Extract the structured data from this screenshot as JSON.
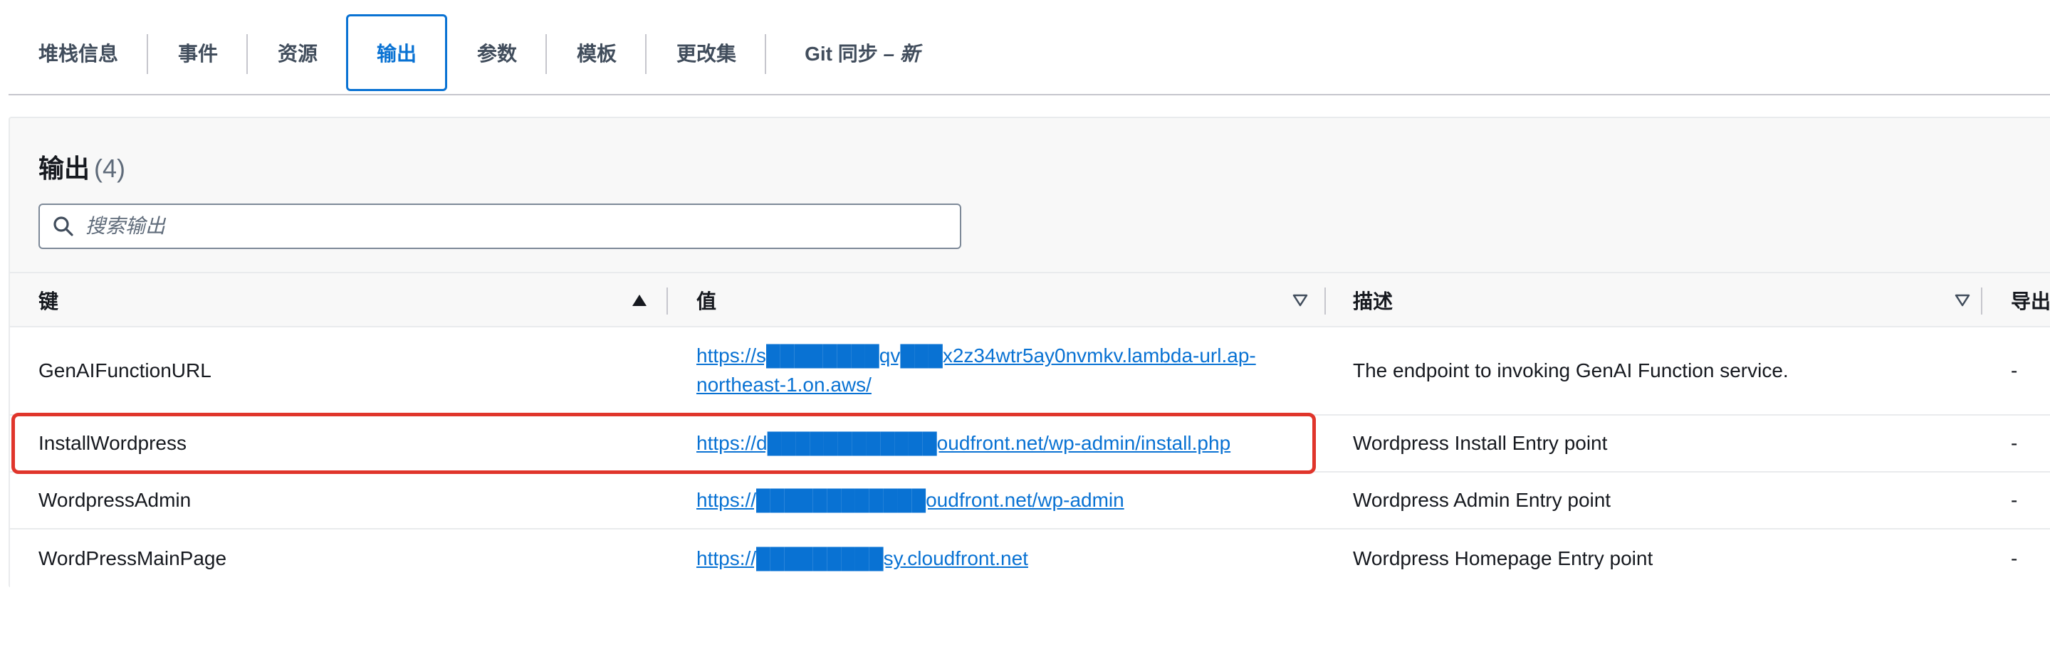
{
  "tabs": [
    {
      "label": "堆栈信息"
    },
    {
      "label": "事件"
    },
    {
      "label": "资源"
    },
    {
      "label": "输出"
    },
    {
      "label": "参数"
    },
    {
      "label": "模板"
    },
    {
      "label": "更改集"
    },
    {
      "label": "Git 同步",
      "suffix": "– 新"
    }
  ],
  "active_tab": "输出",
  "outputs": {
    "title": "输出",
    "count": "(4)",
    "search_placeholder": "搜索输出",
    "columns": {
      "key": "键",
      "value": "值",
      "description": "描述",
      "export": "导出"
    },
    "rows": [
      {
        "key": "GenAIFunctionURL",
        "value_line1": "https://s████████qv███x2z34wtr5ay0nvmkv.lambda-url.ap-",
        "value_line2": "northeast-1.on.aws/",
        "description": "The endpoint to invoking GenAI Function service.",
        "export": "-"
      },
      {
        "key": "InstallWordpress",
        "value": "https://d████████████oudfront.net/wp-admin/install.php",
        "description": "Wordpress Install Entry point",
        "export": "-"
      },
      {
        "key": "WordpressAdmin",
        "value": "https://████████████oudfront.net/wp-admin",
        "description": "Wordpress Admin Entry point",
        "export": "-"
      },
      {
        "key": "WordPressMainPage",
        "value": "https://█████████sy.cloudfront.net",
        "description": "Wordpress Homepage Entry point",
        "export": "-"
      }
    ]
  },
  "colors": {
    "accent": "#0972d3",
    "highlight": "#e0352b"
  },
  "icons": {
    "search": "search-icon",
    "sort_asc": "sort-ascending-icon",
    "sort_desc": "sort-descending-icon"
  }
}
